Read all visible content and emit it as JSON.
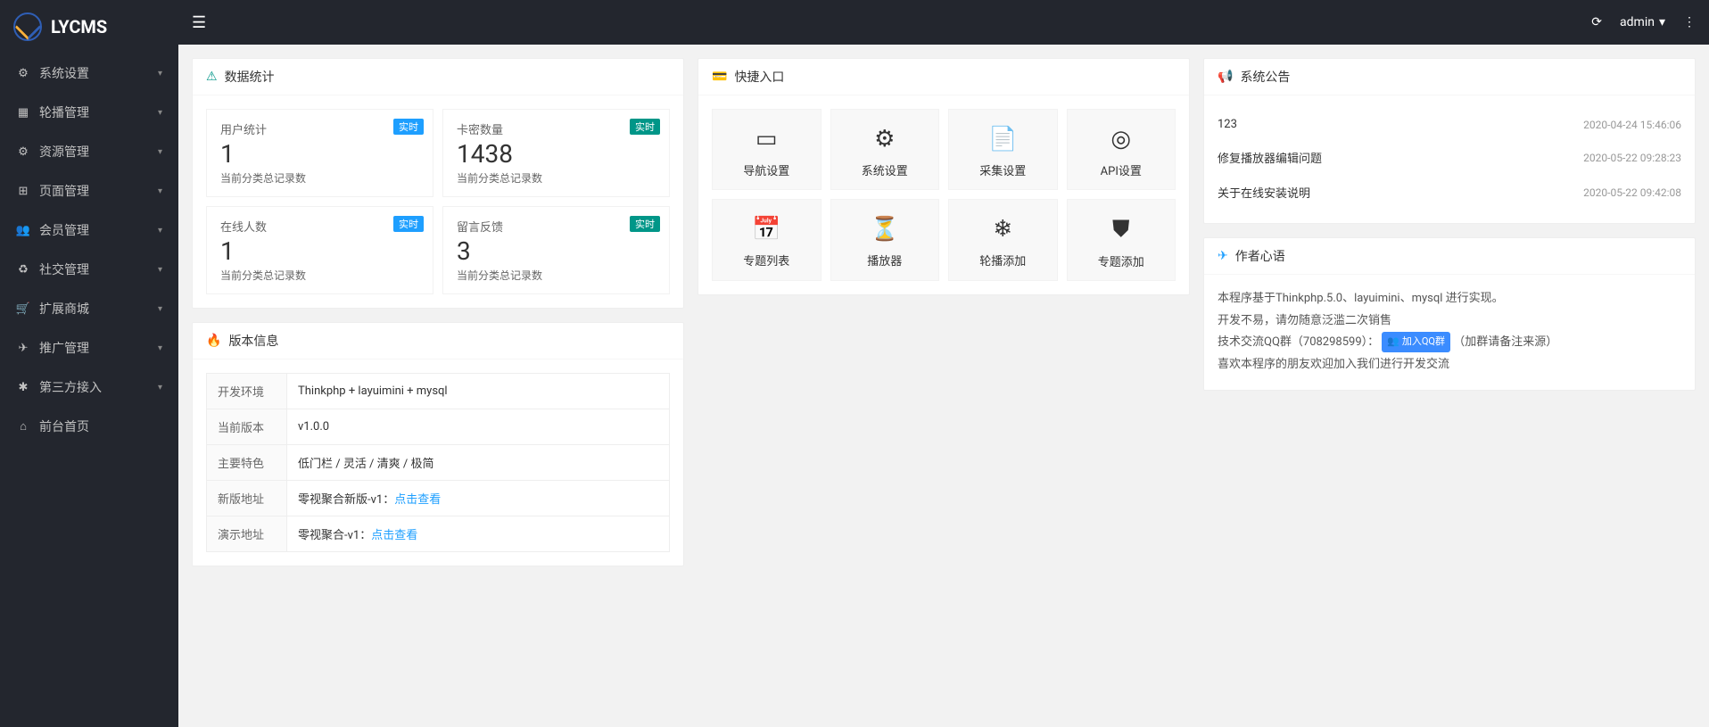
{
  "app": {
    "name": "LYCMS"
  },
  "user": {
    "name": "admin"
  },
  "sidebar": {
    "items": [
      {
        "label": "系统设置",
        "icon": "⚙"
      },
      {
        "label": "轮播管理",
        "icon": "▦"
      },
      {
        "label": "资源管理",
        "icon": "⚙"
      },
      {
        "label": "页面管理",
        "icon": "⊞"
      },
      {
        "label": "会员管理",
        "icon": "👥"
      },
      {
        "label": "社交管理",
        "icon": "♻"
      },
      {
        "label": "扩展商城",
        "icon": "🛒"
      },
      {
        "label": "推广管理",
        "icon": "✈"
      },
      {
        "label": "第三方接入",
        "icon": "✱"
      },
      {
        "label": "前台首页",
        "icon": "⌂"
      }
    ]
  },
  "dataStats": {
    "title": "数据统计",
    "items": [
      {
        "title": "用户统计",
        "value": "1",
        "sub": "当前分类总记录数",
        "badge": "实时",
        "badgeColor": "blue"
      },
      {
        "title": "卡密数量",
        "value": "1438",
        "sub": "当前分类总记录数",
        "badge": "实时",
        "badgeColor": "green"
      },
      {
        "title": "在线人数",
        "value": "1",
        "sub": "当前分类总记录数",
        "badge": "实时",
        "badgeColor": "blue"
      },
      {
        "title": "留言反馈",
        "value": "3",
        "sub": "当前分类总记录数",
        "badge": "实时",
        "badgeColor": "green"
      }
    ]
  },
  "quick": {
    "title": "快捷入口",
    "items": [
      {
        "label": "导航设置",
        "icon": "▭"
      },
      {
        "label": "系统设置",
        "icon": "⚙"
      },
      {
        "label": "采集设置",
        "icon": "📄"
      },
      {
        "label": "API设置",
        "icon": "◎"
      },
      {
        "label": "专题列表",
        "icon": "📅"
      },
      {
        "label": "播放器",
        "icon": "⏳"
      },
      {
        "label": "轮播添加",
        "icon": "❄"
      },
      {
        "label": "专题添加",
        "icon": "⛊"
      }
    ]
  },
  "version": {
    "title": "版本信息",
    "rows": [
      {
        "k": "开发环境",
        "v": "Thinkphp + layuimini + mysql"
      },
      {
        "k": "当前版本",
        "v": "v1.0.0"
      },
      {
        "k": "主要特色",
        "v": "低门栏 / 灵活 / 清爽 / 极简"
      },
      {
        "k": "新版地址",
        "v": "零视聚合新版-v1：",
        "link": "点击查看"
      },
      {
        "k": "演示地址",
        "v": "零视聚合-v1：",
        "link": "点击查看"
      }
    ]
  },
  "notice": {
    "title": "系统公告",
    "items": [
      {
        "text": "123",
        "time": "2020-04-24 15:46:06"
      },
      {
        "text": "修复播放器编辑问题",
        "time": "2020-05-22 09:28:23"
      },
      {
        "text": "关于在线安装说明",
        "time": "2020-05-22 09:42:08"
      }
    ]
  },
  "author": {
    "title": "作者心语",
    "line1": "本程序基于Thinkphp.5.0、layuimini、mysql 进行实现。",
    "line2": "开发不易，请勿随意泛滥二次销售",
    "line3_pre": "技术交流QQ群（708298599）：",
    "line3_badge": "加入QQ群",
    "line3_post": "（加群请备注来源）",
    "line4": "喜欢本程序的朋友欢迎加入我们进行开发交流"
  }
}
